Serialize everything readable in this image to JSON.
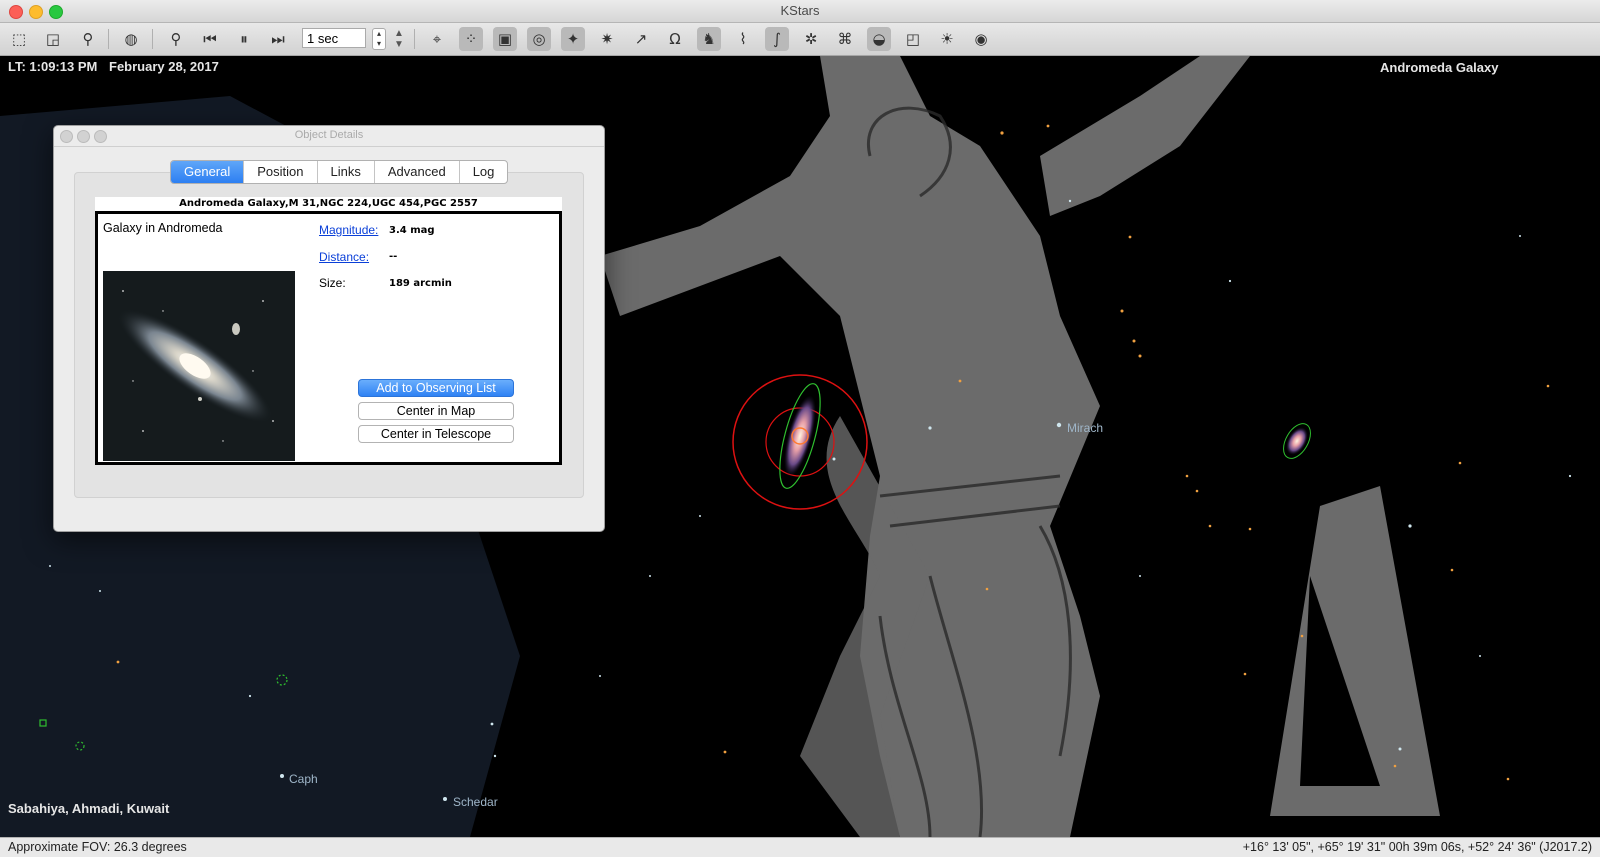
{
  "window": {
    "title": "KStars"
  },
  "toolbar": {
    "time_step": "1 sec",
    "icons": [
      "zoom-box-icon",
      "fullscreen-box-icon",
      "find-icon",
      "globe-icon",
      "zoom-icon",
      "step-back-icon",
      "pause-icon",
      "step-forward-icon",
      "target-icon",
      "stars-icon",
      "deep-sky-icon",
      "solar-system-icon",
      "satellite-icon",
      "supernova-icon",
      "constellation-lines-icon",
      "constellation-names-icon",
      "constellation-art-icon",
      "constellation-bounds-icon",
      "milky-way-icon",
      "equatorial-grid-icon",
      "horizontal-grid-icon",
      "ground-icon",
      "fov-icon",
      "observing-list-icon",
      "eye-icon"
    ]
  },
  "sky": {
    "local_time": "LT: 1:09:13 PM",
    "date": "February 28, 2017",
    "focus_object": "Andromeda Galaxy",
    "location": "Sabahiya, Ahmadi, Kuwait",
    "labels": {
      "mirach": "Mirach",
      "caph": "Caph",
      "schedar": "Schedar"
    }
  },
  "dialog": {
    "title": "Object Details",
    "tabs": [
      {
        "label": "General",
        "selected": true
      },
      {
        "label": "Position",
        "selected": false
      },
      {
        "label": "Links",
        "selected": false
      },
      {
        "label": "Advanced",
        "selected": false
      },
      {
        "label": "Log",
        "selected": false
      }
    ],
    "header": "Andromeda Galaxy,M 31,NGC 224,UGC 454,PGC 2557",
    "type": "Galaxy in Andromeda",
    "fields": {
      "magnitude_label": "Magnitude:",
      "magnitude_value": "3.4 mag",
      "distance_label": "Distance:",
      "distance_value": "--",
      "size_label": "Size:",
      "size_value": "189 arcmin"
    },
    "buttons": {
      "add_observing": "Add to Observing List",
      "center_map": "Center in Map",
      "center_telescope": "Center in Telescope"
    }
  },
  "status": {
    "fov": "Approximate FOV: 26.3 degrees",
    "coords": "+16° 13' 05\", +65° 19' 31\"  00h 39m 06s, +52° 24' 36\" (J2017.2)"
  }
}
